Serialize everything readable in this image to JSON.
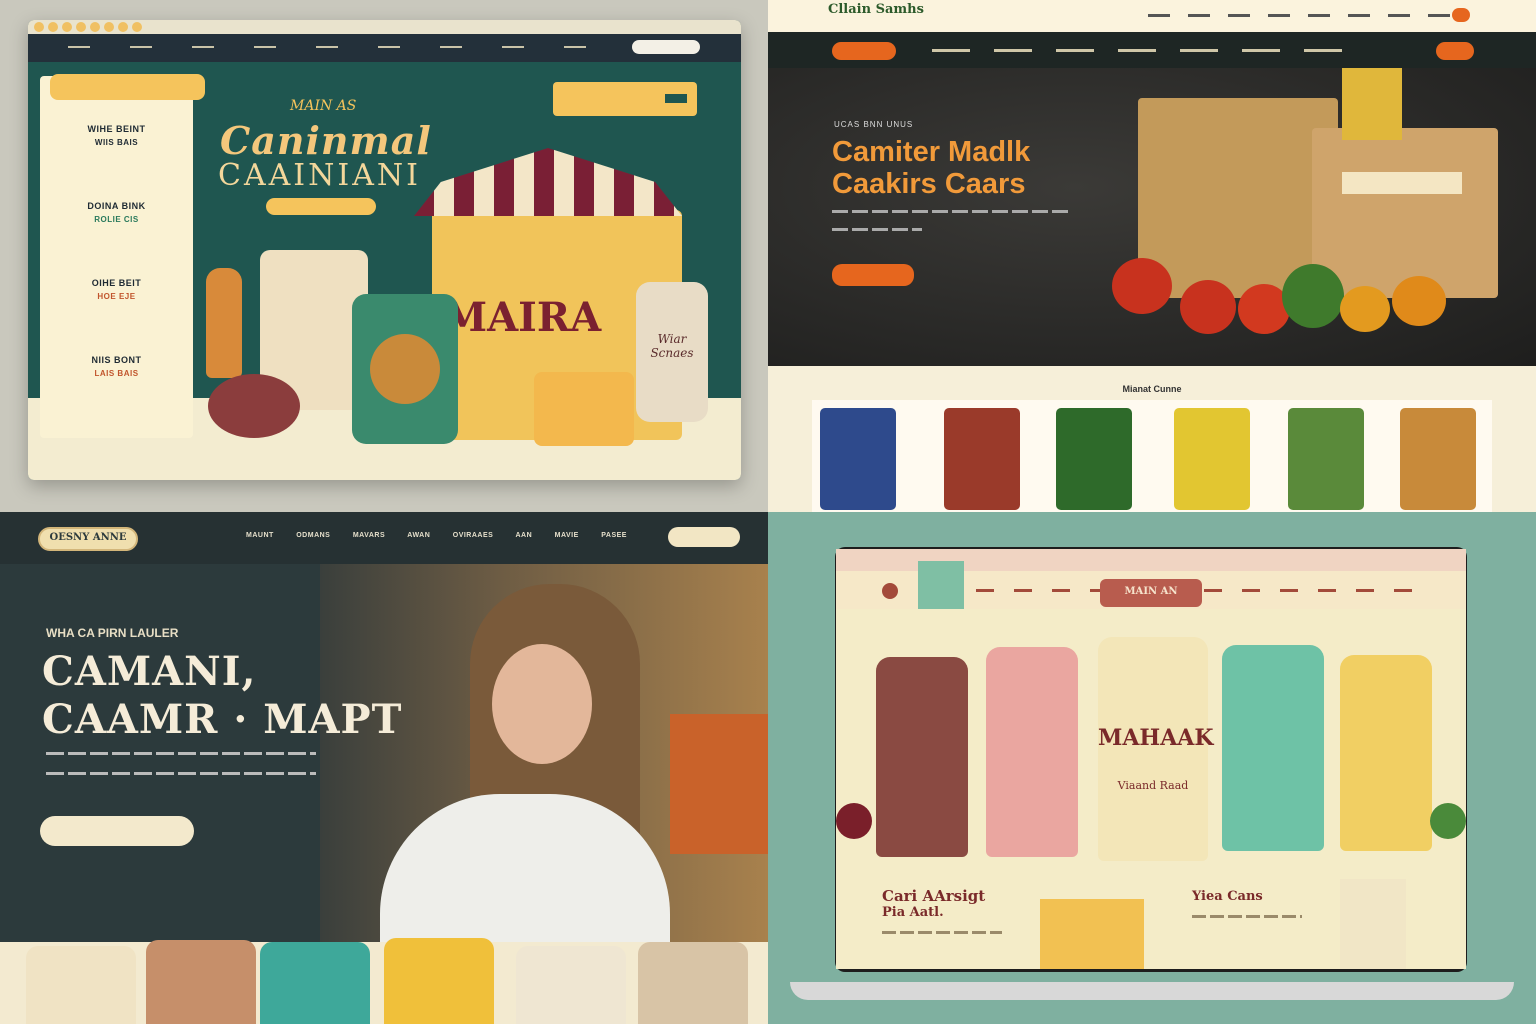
{
  "q1": {
    "hero_small": "MAIN AS",
    "hero_title": "Caninmal",
    "hero_subtitle": "CAAINIANI",
    "sidebar_items": [
      {
        "title": "WIHE BEINT",
        "sub": "WIIS BAIS"
      },
      {
        "title": "DOINA BINK",
        "sub": "ROLIE CIS"
      },
      {
        "title": "OIHE BEIT",
        "sub": "HOE EJE"
      },
      {
        "title": "NIIS BONT",
        "sub": "LAIS BAIS"
      }
    ],
    "box_label": "MAIRA",
    "jar_label": "Wiar Scnaes"
  },
  "q2": {
    "logo": "Cllain Samhs",
    "hero_eyebrow": "UCAS BNN   UNUS",
    "hero_title_1": "Camiter Madlk",
    "hero_title_2": "Caakirs Caars",
    "products_title": "Mianat Cunne",
    "cta_label": ""
  },
  "q3": {
    "logo": "OESNY ANNE",
    "eyebrow": "WHA CA PIRN LAULER",
    "title_1": "CAMANI,",
    "title_2": "CAAMR · MAPT",
    "nav_items": [
      "MAUNT",
      "ODMANS",
      "MAVARS",
      "AWAN",
      "OVIRAAES",
      "AAN",
      "MAVIE",
      "PASEE"
    ]
  },
  "q4": {
    "banner": "MAIN AN",
    "pack_label": "MAHAAK",
    "pack_sub": "Viaand Raad",
    "bottom_left_1": "Cari AArsigt",
    "bottom_left_2": "Pia Aatl.",
    "bottom_right": "Yiea Cans"
  },
  "colors": {
    "teal": "#1f5650",
    "mustard": "#f5c45c",
    "orange": "#e6661e",
    "cream": "#f6efd9",
    "mint": "#7fb0a0"
  }
}
